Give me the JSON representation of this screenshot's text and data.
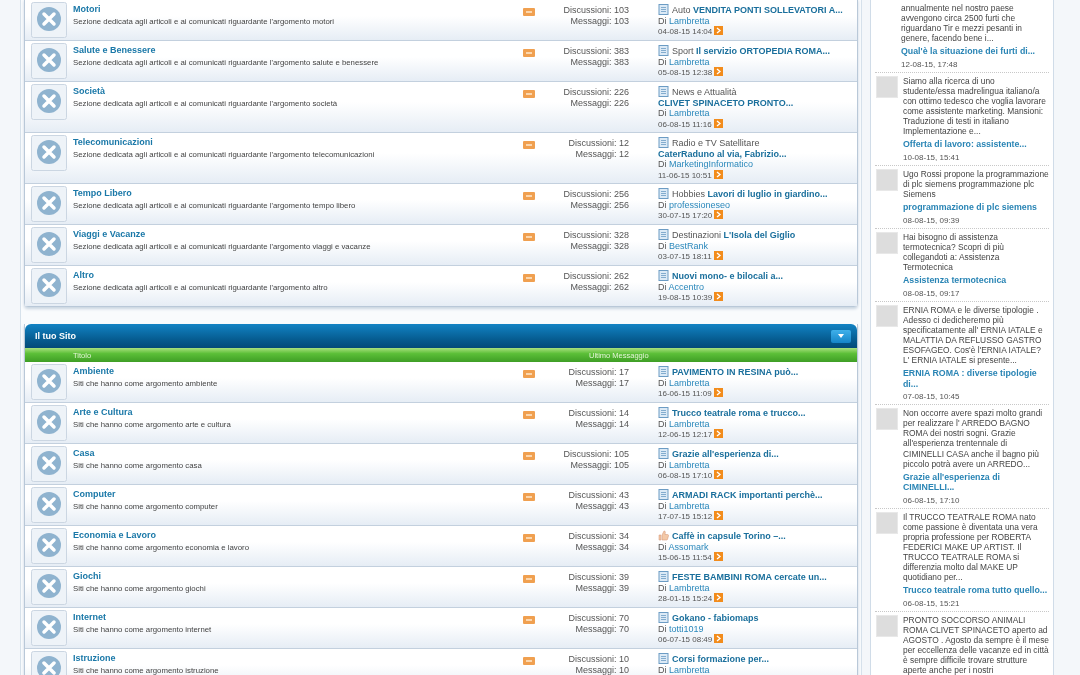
{
  "sections": [
    {
      "rows": [
        {
          "title": "Motori",
          "description": "Sezione dedicata agli articoli e ai comunicati riguardante l'argomento motori",
          "discussions": "Discussioni: 103",
          "messages": "Messaggi: 103",
          "last_post": {
            "kind": "document",
            "prefix": "Auto",
            "title": "VENDITA PONTI SOLLEVATORI A...",
            "by": "Di",
            "author": "Lambretta",
            "date": "04-08-15 14:04"
          }
        },
        {
          "title": "Salute e Benessere",
          "description": "Sezione dedicata agli articoli e ai comunicati riguardante l'argomento salute e benessere",
          "discussions": "Discussioni: 383",
          "messages": "Messaggi: 383",
          "last_post": {
            "kind": "document",
            "prefix": "Sport",
            "title": "Il servizio ORTOPEDIA ROMA...",
            "by": "Di",
            "author": "Lambretta",
            "date": "05-08-15 12:38"
          }
        },
        {
          "title": "Società",
          "description": "Sezione dedicata agli articoli e ai comunicati riguardante l'argomento società",
          "discussions": "Discussioni: 226",
          "messages": "Messaggi: 226",
          "last_post": {
            "kind": "document",
            "prefix": "News e Attualità",
            "title": "CLIVET SPINACETO PRONTO...",
            "by": "Di",
            "author": "Lambretta",
            "date": "06-08-15 11:16"
          }
        },
        {
          "title": "Telecomunicazioni",
          "description": "Sezione dedicata agli articoli e ai comunicati riguardante l'argomento telecomunicazioni",
          "discussions": "Discussioni: 12",
          "messages": "Messaggi: 12",
          "last_post": {
            "kind": "document",
            "prefix": "Radio e TV Satellitare",
            "title": "CaterRaduno al via, Fabrizio...",
            "by": "Di",
            "author": "MarketingInformatico",
            "date": "11-06-15 10:51"
          }
        },
        {
          "title": "Tempo Libero",
          "description": "Sezione dedicata agli articoli e ai comunicati riguardante l'argomento tempo libero",
          "discussions": "Discussioni: 256",
          "messages": "Messaggi: 256",
          "last_post": {
            "kind": "document",
            "prefix": "Hobbies",
            "title": "Lavori di luglio in giardino...",
            "by": "Di",
            "author": "professioneseo",
            "date": "30-07-15 17:20"
          }
        },
        {
          "title": "Viaggi e Vacanze",
          "description": "Sezione dedicata agli articoli e ai comunicati riguardante l'argomento viaggi e vacanze",
          "discussions": "Discussioni: 328",
          "messages": "Messaggi: 328",
          "last_post": {
            "kind": "document",
            "prefix": "Destinazioni",
            "title": "L'Isola del Giglio",
            "by": "Di",
            "author": "BestRank",
            "date": "03-07-15 18:11"
          }
        },
        {
          "title": "Altro",
          "description": "Sezione dedicata agli articoli e ai comunicati riguardante l'argomento altro",
          "discussions": "Discussioni: 262",
          "messages": "Messaggi: 262",
          "last_post": {
            "kind": "document",
            "title": "Nuovi mono- e bilocali a...",
            "by": "Di",
            "author": "Accentro",
            "date": "19-08-15 10:39"
          }
        }
      ]
    },
    {
      "title": "Il tuo Sito",
      "columns": [
        "Titolo",
        "Ultimo Messaggio"
      ],
      "rows": [
        {
          "title": "Ambiente",
          "description": "Siti che hanno come argomento ambiente",
          "discussions": "Discussioni: 17",
          "messages": "Messaggi: 17",
          "last_post": {
            "kind": "document",
            "title": "PAVIMENTO IN RESINA può...",
            "by": "Di",
            "author": "Lambretta",
            "date": "16-06-15 11:09"
          }
        },
        {
          "title": "Arte e Cultura",
          "description": "Siti che hanno come argomento arte e cultura",
          "discussions": "Discussioni: 14",
          "messages": "Messaggi: 14",
          "last_post": {
            "kind": "document",
            "title": "Trucco teatrale roma e trucco...",
            "by": "Di",
            "author": "Lambretta",
            "date": "12-06-15 12:17"
          }
        },
        {
          "title": "Casa",
          "description": "Siti che hanno come argomento casa",
          "discussions": "Discussioni: 105",
          "messages": "Messaggi: 105",
          "last_post": {
            "kind": "document",
            "title": "Grazie all'esperienza di...",
            "by": "Di",
            "author": "Lambretta",
            "date": "06-08-15 17:10"
          }
        },
        {
          "title": "Computer",
          "description": "Siti che hanno come argomento computer",
          "discussions": "Discussioni: 43",
          "messages": "Messaggi: 43",
          "last_post": {
            "kind": "document",
            "title": "ARMADI RACK importanti perchè...",
            "by": "Di",
            "author": "Lambretta",
            "date": "17-07-15 15:12"
          }
        },
        {
          "title": "Economia e Lavoro",
          "description": "Siti che hanno come argomento economia e lavoro",
          "discussions": "Discussioni: 34",
          "messages": "Messaggi: 34",
          "last_post": {
            "kind": "thumb",
            "title": "Caffè in capsule Torino –...",
            "by": "Di",
            "author": "Assomark",
            "date": "15-06-15 11:54"
          }
        },
        {
          "title": "Giochi",
          "description": "Siti che hanno come argomento giochi",
          "discussions": "Discussioni: 39",
          "messages": "Messaggi: 39",
          "last_post": {
            "kind": "document",
            "title": "FESTE BAMBINI ROMA cercate un...",
            "by": "Di",
            "author": "Lambretta",
            "date": "28-01-15 15:24"
          }
        },
        {
          "title": "Internet",
          "description": "Siti che hanno come argomento internet",
          "discussions": "Discussioni: 70",
          "messages": "Messaggi: 70",
          "last_post": {
            "kind": "document",
            "title": "Gokano - fabiomaps",
            "by": "Di",
            "author": "totti1019",
            "date": "06-07-15 08:49"
          }
        },
        {
          "title": "Istruzione",
          "description": "Siti che hanno come argomento istruzione",
          "discussions": "Discussioni: 10",
          "messages": "Messaggi: 10",
          "last_post": {
            "kind": "document",
            "title": "Corsi formazione per...",
            "by": "Di",
            "author": "Lambretta"
          }
        }
      ]
    }
  ],
  "sidebar": [
    {
      "avatar": false,
      "text": "annualmente nel nostro paese avvengono circa 2500 furti che riguardano Tir e mezzi pesanti in genere, facendo bene i...",
      "link": "Qual'è la situazione dei furti di...",
      "date": "12-08-15, 17:48"
    },
    {
      "avatar": true,
      "text": "Siamo alla ricerca di uno studente/essa madrelingua italiano/a con ottimo tedesco che voglia lavorare come assistente marketing. Mansioni: Traduzione di testi in italiano Implementazione e...",
      "link": "Offerta di lavoro: assistente...",
      "date": "10-08-15, 15:41"
    },
    {
      "avatar": true,
      "text": "Ugo Rossi propone la programmazione di plc siemens programmazione plc Siemens",
      "link": "programmazione di plc siemens",
      "date": "08-08-15, 09:39"
    },
    {
      "avatar": true,
      "text": "Hai bisogno di assistenza termotecnica? Scopri di più collegandoti a: Assistenza Termotecnica",
      "link": "Assistenza termotecnica",
      "date": "08-08-15, 09:17"
    },
    {
      "avatar": true,
      "text": "ERNIA ROMA e le diverse tipologie . Adesso ci dedicheremo più specificatamente all' ERNIA IATALE e MALATTIA DA REFLUSSO GASTRO ESOFAGEO. Cos'è l'ERNIA IATALE? L' ERNIA IATALE si presente...",
      "link": "ERNIA ROMA : diverse tipologie di...",
      "date": "07-08-15, 10:45"
    },
    {
      "avatar": true,
      "text": "Non occorre avere spazi molto grandi per realizzare l' ARREDO BAGNO ROMA dei nostri sogni. Grazie all'esperienza trentennale di CIMINELLI CASA anche il bagno più piccolo potrà avere un ARREDO...",
      "link": "Grazie all'esperienza di CIMINELLI...",
      "date": "06-08-15, 17:10"
    },
    {
      "avatar": true,
      "text": "Il TRUCCO TEATRALE ROMA nato come passione è diventata una vera propria professione per ROBERTA FEDERICI MAKE UP ARTIST. Il TRUCCO TEATRALE ROMA si differenzia molto dal MAKE UP quotidiano per...",
      "link": "Trucco teatrale roma tutto quello...",
      "date": "06-08-15, 15:21"
    },
    {
      "avatar": true,
      "text": "PRONTO SOCCORSO ANIMALI ROMA CLIVET SPINACETO aperto ad AGOSTO . Agosto da sempre è il mese per eccellenza delle vacanze ed in città è sempre difficile trovare strutture aperte anche per i nostri"
    }
  ]
}
